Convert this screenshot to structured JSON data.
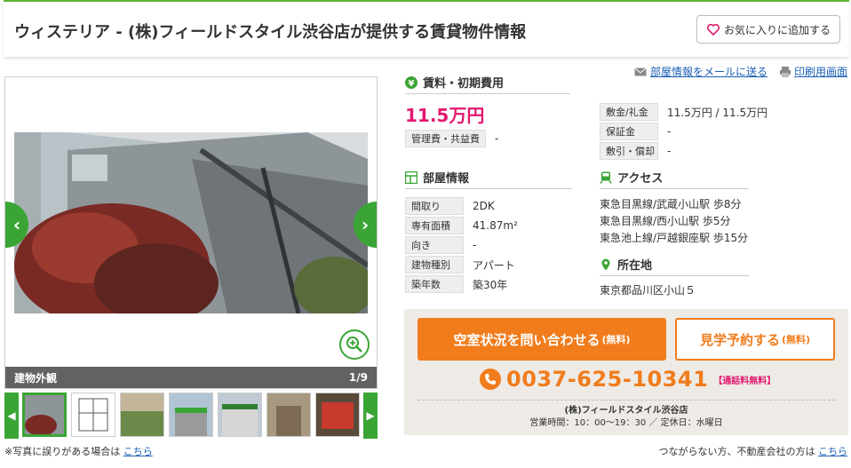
{
  "header": {
    "title": "ウィステリア - (株)フィールドスタイル渋谷店が提供する賃貸物件情報",
    "fav_label": "お気に入りに追加する"
  },
  "gallery": {
    "caption": "建物外観",
    "counter": "1/9",
    "note": "※写真に誤りがある場合は",
    "note_link": "こちら"
  },
  "links": {
    "email": "部屋情報をメールに送る",
    "print": "印刷用画面"
  },
  "rent": {
    "heading": "賃料・初期費用",
    "amount": "11.5万円",
    "mgmt_label": "管理費・共益費",
    "mgmt_value": "-",
    "deposit_label": "敷金/礼金",
    "deposit_value": "11.5万円 / 11.5万円",
    "guarantee_label": "保証金",
    "guarantee_value": "-",
    "shikibiki_label": "敷引・償却",
    "shikibiki_value": "-"
  },
  "room": {
    "heading": "部屋情報",
    "rows": [
      {
        "label": "間取り",
        "value": "2DK"
      },
      {
        "label": "専有面積",
        "value": "41.87m²"
      },
      {
        "label": "向き",
        "value": "-"
      },
      {
        "label": "建物種別",
        "value": "アパート"
      },
      {
        "label": "築年数",
        "value": "築30年"
      }
    ]
  },
  "access": {
    "heading": "アクセス",
    "lines": [
      "東急目黒線/武蔵小山駅 歩8分",
      "東急目黒線/西小山駅 歩5分",
      "東急池上線/戸越銀座駅 歩15分"
    ]
  },
  "location": {
    "heading": "所在地",
    "address": "東京都品川区小山５"
  },
  "cta": {
    "inquire": "空室状況を問い合わせる",
    "inquire_small": "(無料)",
    "visit": "見学予約する",
    "visit_small": "(無料)",
    "phone": "0037-625-10341",
    "phone_badge": "【通話料無料】",
    "company": "(株)フィールドスタイル渋谷店",
    "hours": "営業時間：10：00〜19：30 ／ 定休日：水曜日"
  },
  "footer": {
    "note": "つながらない方、不動産会社の方は",
    "link": "こちら"
  },
  "colors": {
    "brand_green": "#3aa535",
    "accent_orange": "#f07c1c",
    "price_pink": "#e2186f"
  }
}
